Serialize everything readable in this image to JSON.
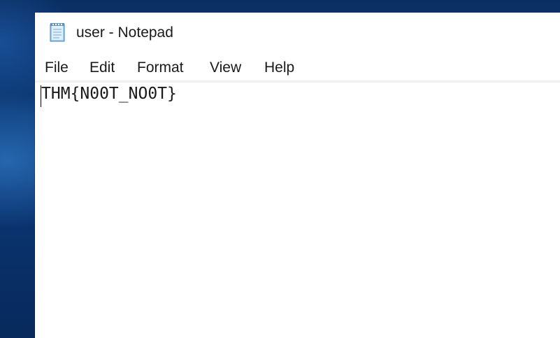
{
  "window": {
    "title": "user - Notepad",
    "icon": "notepad-icon"
  },
  "menu": {
    "items": [
      {
        "label": "File"
      },
      {
        "label": "Edit"
      },
      {
        "label": "Format"
      },
      {
        "label": "View"
      },
      {
        "label": "Help"
      }
    ]
  },
  "editor": {
    "content": "THM{N00T_NO0T}"
  },
  "colors": {
    "desktop_background": "#0d3a72",
    "window_background": "#ffffff",
    "text": "#1a1a1a"
  }
}
